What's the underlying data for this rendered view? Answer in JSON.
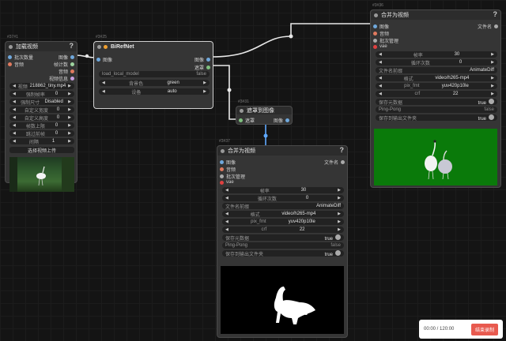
{
  "colors": {
    "image": "#6fa8dc",
    "mask": "#7ec07e",
    "audio": "#e07a5f",
    "wire": "#e8e8e8",
    "link": "#5fa9ff",
    "green": "#0a7a0a"
  },
  "node_load": {
    "id": "#37#1",
    "title": "加载视频",
    "outputs": [
      "批次数量",
      "音频"
    ],
    "outputs_right": [
      "图像",
      "帧计数",
      "音频",
      "视频信息"
    ],
    "widgets": [
      {
        "label": "视频",
        "value": "218862_tiny.mp4"
      },
      {
        "label": "强制帧率",
        "value": "0"
      },
      {
        "label": "强制尺寸",
        "value": "Disabled"
      },
      {
        "label": "自定义宽度",
        "value": "0"
      },
      {
        "label": "自定义高度",
        "value": "0"
      },
      {
        "label": "帧数上限",
        "value": "0"
      },
      {
        "label": "跳过前帧",
        "value": "0"
      },
      {
        "label": "间隔",
        "value": "1"
      }
    ],
    "upload_label": "选择视频上传"
  },
  "node_birefnet": {
    "id": "#3#25",
    "title": "BiRefNet",
    "input": "图像",
    "outputs": [
      "图像",
      "遮罩"
    ],
    "widgets": [
      {
        "label": "load_local_model",
        "value": "false"
      },
      {
        "label": "背景色",
        "value": "green"
      },
      {
        "label": "设备",
        "value": "auto"
      }
    ]
  },
  "node_mask_to_image": {
    "id": "#3#31",
    "title": "遮罩到图像",
    "input": "遮罩",
    "output": "图像"
  },
  "node_combine_top": {
    "id": "#3#36",
    "title": "合并为视频",
    "inputs": [
      "图像",
      "音频",
      "批次管理",
      "vae"
    ],
    "output": "文件名",
    "widgets": [
      {
        "label": "帧率",
        "value": "30"
      },
      {
        "label": "循环次数",
        "value": "0"
      },
      {
        "label": "文件名前缀",
        "value": "AnimateDiff"
      },
      {
        "label": "格式",
        "value": "video/h265-mp4"
      },
      {
        "label": "pix_fmt",
        "value": "yuv420p10le"
      },
      {
        "label": "crf",
        "value": "22"
      },
      {
        "label": "保存元数据",
        "value": "true"
      },
      {
        "label": "Ping-Pong",
        "value": "false"
      },
      {
        "label": "保存到输出文件夹",
        "value": "true"
      }
    ]
  },
  "node_combine_bottom": {
    "id": "#3#37",
    "title": "合并为视频",
    "inputs": [
      "图像",
      "音频",
      "批次管理",
      "vae"
    ],
    "output": "文件名",
    "widgets": [
      {
        "label": "帧率",
        "value": "30"
      },
      {
        "label": "循环次数",
        "value": "0"
      },
      {
        "label": "文件名前缀",
        "value": "AnimateDiff"
      },
      {
        "label": "格式",
        "value": "video/h265-mp4"
      },
      {
        "label": "pix_fmt",
        "value": "yuv420p10le"
      },
      {
        "label": "crf",
        "value": "22"
      },
      {
        "label": "保存元数据",
        "value": "true"
      },
      {
        "label": "Ping-Pong",
        "value": "false"
      },
      {
        "label": "保存到输出文件夹",
        "value": "true"
      }
    ]
  },
  "recorder": {
    "time": "00:00 / 120:00",
    "button": "结束录制"
  }
}
